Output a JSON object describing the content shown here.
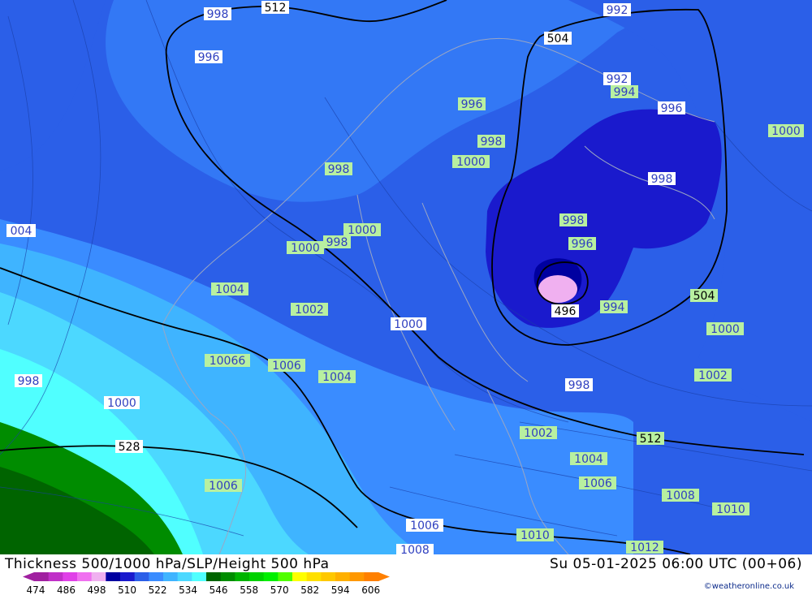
{
  "title": "Thickness 500/1000 hPa/SLP/Height 500 hPa",
  "valid_time": "Su 05-01-2025 06:00 UTC (00+06)",
  "credit": "©weatheronline.co.uk",
  "legend": {
    "ticks": [
      "474",
      "486",
      "498",
      "510",
      "522",
      "534",
      "546",
      "558",
      "570",
      "582",
      "594",
      "606"
    ],
    "colors": [
      "#a020a0",
      "#c030c8",
      "#e040e8",
      "#f070f0",
      "#f0b0f0",
      "#0000a0",
      "#1a1acd",
      "#2b5fe8",
      "#3a8cff",
      "#3fb4ff",
      "#4cd8ff",
      "#50ffff",
      "#006400",
      "#008c00",
      "#00b400",
      "#00d200",
      "#00f000",
      "#50ff00",
      "#ffff00",
      "#ffe000",
      "#ffc800",
      "#ffb000",
      "#ff9800",
      "#ff8000"
    ]
  },
  "height_labels": [
    {
      "text": "512"
    },
    {
      "text": "504"
    },
    {
      "text": "504"
    },
    {
      "text": "496"
    },
    {
      "text": "528"
    },
    {
      "text": "512"
    }
  ],
  "pressure_labels_white": [
    {
      "text": "998"
    },
    {
      "text": "996"
    },
    {
      "text": "992"
    },
    {
      "text": "992"
    },
    {
      "text": "996"
    },
    {
      "text": "998"
    },
    {
      "text": "004"
    },
    {
      "text": "1000"
    },
    {
      "text": "998"
    },
    {
      "text": "1000"
    },
    {
      "text": "998"
    },
    {
      "text": "996"
    },
    {
      "text": "1006"
    },
    {
      "text": "1008"
    }
  ],
  "pressure_labels_green": [
    {
      "text": "994"
    },
    {
      "text": "996"
    },
    {
      "text": "998"
    },
    {
      "text": "1000"
    },
    {
      "text": "1000"
    },
    {
      "text": "998"
    },
    {
      "text": "996"
    },
    {
      "text": "1000"
    },
    {
      "text": "1000"
    },
    {
      "text": "998"
    },
    {
      "text": "1004"
    },
    {
      "text": "1002"
    },
    {
      "text": "10066"
    },
    {
      "text": "1006"
    },
    {
      "text": "1004"
    },
    {
      "text": "994"
    },
    {
      "text": "504"
    },
    {
      "text": "1000"
    },
    {
      "text": "1002"
    },
    {
      "text": "998"
    },
    {
      "text": "1002"
    },
    {
      "text": "1004"
    },
    {
      "text": "1006"
    },
    {
      "text": "1008"
    },
    {
      "text": "1010"
    },
    {
      "text": "1006"
    },
    {
      "text": "1010"
    },
    {
      "text": "1012"
    }
  ]
}
